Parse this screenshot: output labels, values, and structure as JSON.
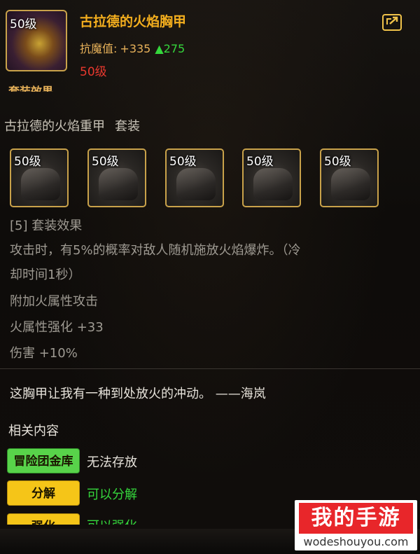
{
  "header": {
    "icon_level": "50级",
    "title": "古拉德的火焰胸甲",
    "stat_label": "抗魔值:",
    "stat_value": "+335",
    "stat_bonus": "▲275",
    "required_level": "50级",
    "share_icon": "share-arrow-icon"
  },
  "cut_text": "套装效果",
  "set": {
    "name": "古拉德的火焰重甲",
    "suffix": "套装",
    "pieces": [
      {
        "level": "50级",
        "icon": "shoulder-armor-icon"
      },
      {
        "level": "50级",
        "icon": "chest-armor-icon"
      },
      {
        "level": "50级",
        "icon": "belt-armor-icon"
      },
      {
        "level": "50级",
        "icon": "leg-armor-icon"
      },
      {
        "level": "50级",
        "icon": "boots-armor-icon"
      }
    ]
  },
  "effect": {
    "header": "[5] 套装效果",
    "line1": "攻击时，有5%的概率对敌人随机施放火焰爆炸。（冷",
    "line2": "却时间1秒）",
    "line3": "附加火属性攻击",
    "line4": "火属性强化 +33",
    "line5": "伤害 +10%"
  },
  "quote": "这胸甲让我有一种到处放火的冲动。 ——海岚",
  "related": {
    "title": "相关内容",
    "items": [
      {
        "tag": "冒险团金库",
        "desc": "无法存放",
        "tag_color": "#58d34a",
        "desc_color": "#e6e2da"
      },
      {
        "tag": "分解",
        "desc": "可以分解",
        "tag_color": "#f5c518",
        "desc_color": "#35d63c"
      },
      {
        "tag": "强化",
        "desc": "可以强化",
        "tag_color": "#f5c518",
        "desc_color": "#35d63c"
      }
    ]
  },
  "watermark": {
    "brand": "我的手游",
    "url": "wodeshouyou.com"
  }
}
